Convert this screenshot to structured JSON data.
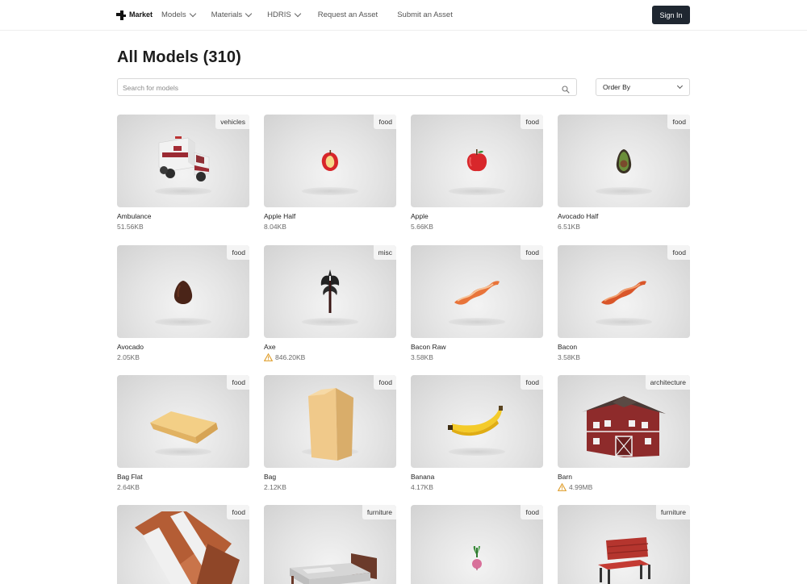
{
  "header": {
    "brand": "Market",
    "nav": [
      {
        "label": "Models",
        "dropdown": true
      },
      {
        "label": "Materials",
        "dropdown": true
      },
      {
        "label": "HDRIS",
        "dropdown": true
      },
      {
        "label": "Request an Asset",
        "dropdown": false
      },
      {
        "label": "Submit an Asset",
        "dropdown": false
      }
    ],
    "signin_label": "Sign In"
  },
  "page": {
    "title": "All Models (310)",
    "search_placeholder": "Search for models",
    "order_by_label": "Order By"
  },
  "models": [
    {
      "name": "Ambulance",
      "size": "51.56KB",
      "tag": "vehicles",
      "warning": false,
      "icon": "ambulance"
    },
    {
      "name": "Apple Half",
      "size": "8.04KB",
      "tag": "food",
      "warning": false,
      "icon": "apple-half"
    },
    {
      "name": "Apple",
      "size": "5.66KB",
      "tag": "food",
      "warning": false,
      "icon": "apple"
    },
    {
      "name": "Avocado Half",
      "size": "6.51KB",
      "tag": "food",
      "warning": false,
      "icon": "avocado-half"
    },
    {
      "name": "Avocado",
      "size": "2.05KB",
      "tag": "food",
      "warning": false,
      "icon": "avocado"
    },
    {
      "name": "Axe",
      "size": "846.20KB",
      "tag": "misc",
      "warning": true,
      "icon": "axe"
    },
    {
      "name": "Bacon Raw",
      "size": "3.58KB",
      "tag": "food",
      "warning": false,
      "icon": "bacon-raw"
    },
    {
      "name": "Bacon",
      "size": "3.58KB",
      "tag": "food",
      "warning": false,
      "icon": "bacon"
    },
    {
      "name": "Bag Flat",
      "size": "2.64KB",
      "tag": "food",
      "warning": false,
      "icon": "bag-flat"
    },
    {
      "name": "Bag",
      "size": "2.12KB",
      "tag": "food",
      "warning": false,
      "icon": "bag"
    },
    {
      "name": "Banana",
      "size": "4.17KB",
      "tag": "food",
      "warning": false,
      "icon": "banana"
    },
    {
      "name": "Barn",
      "size": "4.99MB",
      "tag": "architecture",
      "warning": true,
      "icon": "barn"
    },
    {
      "name": "",
      "size": "",
      "tag": "food",
      "warning": false,
      "icon": "barrel"
    },
    {
      "name": "",
      "size": "",
      "tag": "furniture",
      "warning": false,
      "icon": "bed"
    },
    {
      "name": "",
      "size": "",
      "tag": "food",
      "warning": false,
      "icon": "beet"
    },
    {
      "name": "",
      "size": "",
      "tag": "furniture",
      "warning": false,
      "icon": "bench"
    }
  ],
  "colors": {
    "signin_bg": "#1f2731",
    "warning": "#e0a030"
  }
}
